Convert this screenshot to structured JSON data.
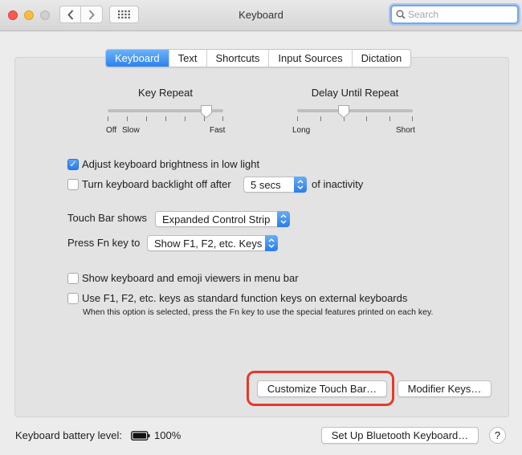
{
  "window": {
    "title": "Keyboard"
  },
  "toolbar": {
    "back_icon": "chevron-left-icon",
    "forward_icon": "chevron-right-icon",
    "grid_icon": "grid-icon",
    "search_placeholder": "Search",
    "search_value": ""
  },
  "tabs": [
    {
      "label": "Keyboard",
      "active": true
    },
    {
      "label": "Text",
      "active": false
    },
    {
      "label": "Shortcuts",
      "active": false
    },
    {
      "label": "Input Sources",
      "active": false
    },
    {
      "label": "Dictation",
      "active": false
    }
  ],
  "key_repeat": {
    "title": "Key Repeat",
    "label_off": "Off",
    "label_slow": "Slow",
    "label_fast": "Fast",
    "level": 0.857
  },
  "delay_until_repeat": {
    "title": "Delay Until Repeat",
    "label_long": "Long",
    "label_short": "Short",
    "level": 0.4
  },
  "options": {
    "adjust_brightness": {
      "label": "Adjust keyboard brightness in low light",
      "checked": true
    },
    "backlight_off": {
      "label": "Turn keyboard backlight off after",
      "checked": false,
      "value": "5 secs",
      "suffix": "of inactivity"
    },
    "touch_bar_shows": {
      "label": "Touch Bar shows",
      "value": "Expanded Control Strip"
    },
    "press_fn": {
      "label": "Press Fn key to",
      "value": "Show F1, F2, etc. Keys"
    },
    "show_viewers": {
      "label": "Show keyboard and emoji viewers in menu bar",
      "checked": false
    },
    "fn_keys": {
      "label": "Use F1, F2, etc. keys as standard function keys on external keyboards",
      "checked": false,
      "note": "When this option is selected, press the Fn key to use the special features printed on each key."
    }
  },
  "buttons": {
    "customize_touch_bar": "Customize Touch Bar…",
    "modifier_keys": "Modifier Keys…",
    "bluetooth": "Set Up Bluetooth Keyboard…",
    "help": "?"
  },
  "battery": {
    "label": "Keyboard battery level:",
    "percent": "100%",
    "icon": "battery-icon"
  },
  "colors": {
    "accent": "#2a82ef",
    "highlight": "#e53a2a"
  }
}
